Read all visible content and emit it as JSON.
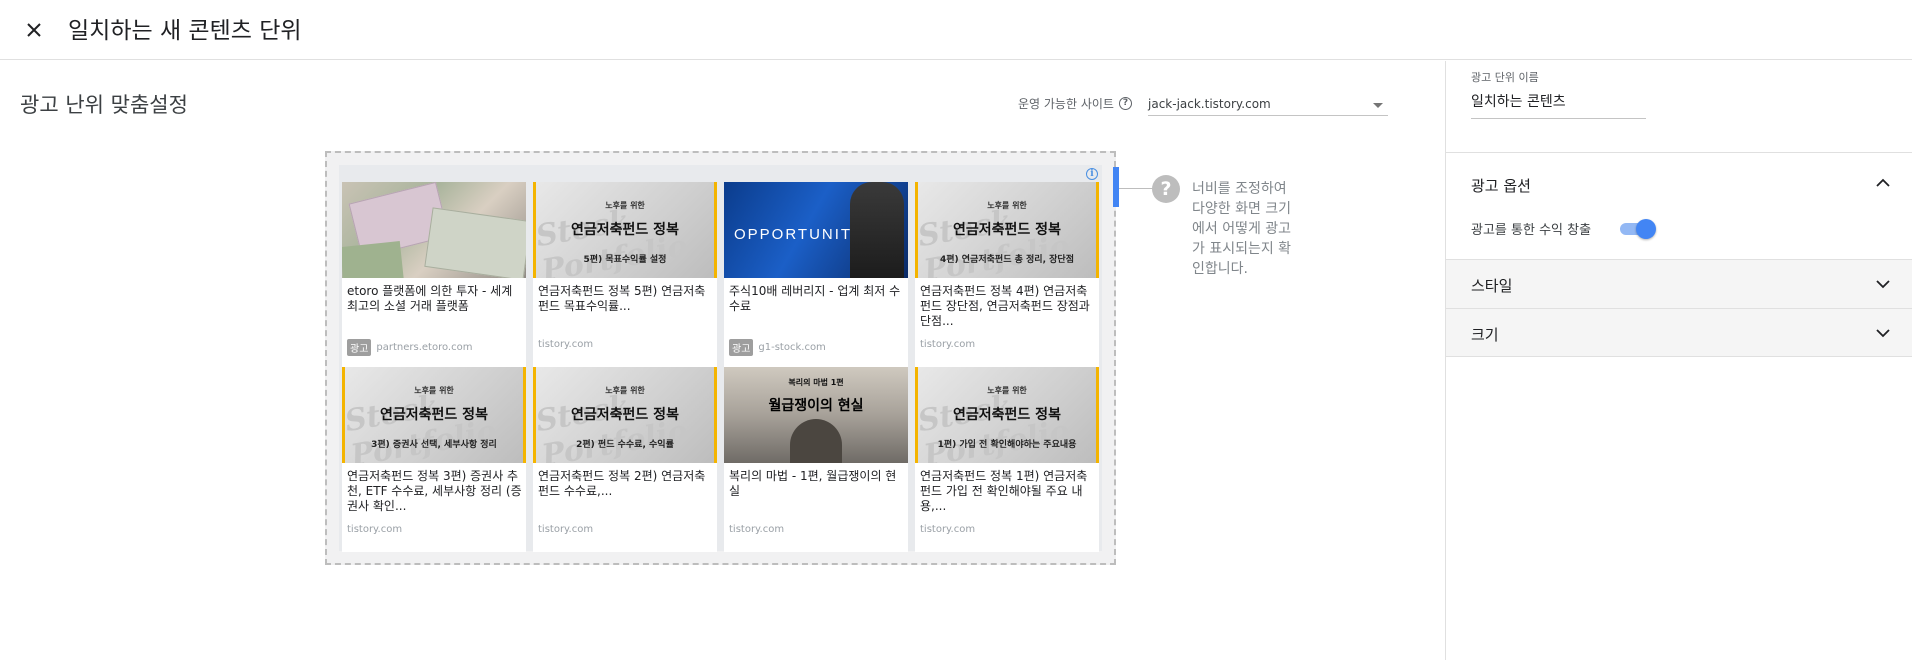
{
  "header": {
    "title": "일치하는 새 콘텐츠 단위",
    "close_icon": "close-icon"
  },
  "main": {
    "section_title": "광고 난위 맞춤설정",
    "site_label": "운영 가능한 사이트",
    "site_value": "jack-jack.tistory.com",
    "hint_text": "너비를 조정하여 다양한 화면 크기에서 어떻게 광고가 표시되는지 확인합니다."
  },
  "preview": {
    "info_icon": "i",
    "cards": [
      {
        "title": "etoro 플랫폼에 의한 투자 - 세계 최고의 소셜 거래 플랫폼",
        "source": "partners.etoro.com",
        "ad_badge": "광고"
      },
      {
        "title": "연금저축펀드 정복 5편) 연금저축펀드 목표수익률...",
        "source": "tistory.com",
        "thumb_small": "노후를 위한",
        "thumb_big": "연금저축펀드 정복",
        "thumb_sub": "5편) 목표수익률 설정"
      },
      {
        "title": "주식10배 레버리지 - 업계 최저 수수료",
        "source": "g1-stock.com",
        "ad_badge": "광고",
        "thumb_word": "OPPORTUNITY"
      },
      {
        "title": "연금저축펀드 정복 4편) 연금저축펀드 장단점, 연금저축펀드 장점과 단점...",
        "source": "tistory.com",
        "thumb_small": "노후를 위한",
        "thumb_big": "연금저축펀드 정복",
        "thumb_sub": "4편) 연금저축펀드 총 정리, 장단점"
      },
      {
        "title": "연금저축펀드 정복 3편) 증권사 추천, ETF 수수료, 세부사항 정리 (증권사 확인...",
        "source": "tistory.com",
        "thumb_small": "노후를 위한",
        "thumb_big": "연금저축펀드 정복",
        "thumb_sub": "3편) 증권사 선택, 세부사항 정리"
      },
      {
        "title": "연금저축펀드 정복 2편) 연금저축펀드 수수료,...",
        "source": "tistory.com",
        "thumb_small": "노후를 위한",
        "thumb_big": "연금저축펀드 정복",
        "thumb_sub": "2편) 펀드 수수료, 수익률"
      },
      {
        "title": "복리의 마법 - 1편, 월급쟁이의 현실",
        "source": "tistory.com",
        "thumb_small": "복리의 마법 1편",
        "thumb_big": "월급쟁이의 현실"
      },
      {
        "title": "연금저축펀드 정복 1편) 연금저축펀드 가입 전 확인해야될 주요 내용,...",
        "source": "tistory.com",
        "thumb_small": "노후를 위한",
        "thumb_big": "연금저축펀드 정복",
        "thumb_sub": "1편) 가입 전 확인해야하는 주요내용"
      }
    ],
    "stock_bg_word": "Stock Portfolio"
  },
  "side": {
    "name_label": "광고 단위 이름",
    "name_value": "일치하는 콘텐츠",
    "options_title": "광고 옵션",
    "toggle_label": "광고를 통한 수익 창출",
    "toggle_on": true,
    "style_label": "스타일",
    "size_label": "크기"
  },
  "colors": {
    "accent": "#4285f4",
    "thumb_border": "#f4b400"
  }
}
